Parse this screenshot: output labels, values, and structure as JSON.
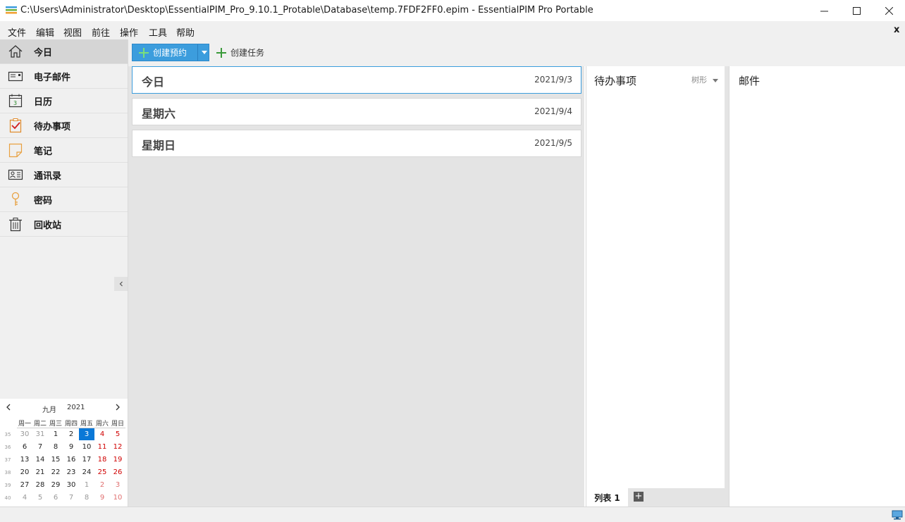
{
  "window": {
    "title": "C:\\Users\\Administrator\\Desktop\\EssentialPIM_Pro_9.10.1_Protable\\Database\\temp.7FDF2FF0.epim - EssentialPIM Pro Portable"
  },
  "menu": {
    "items": [
      "文件",
      "编辑",
      "视图",
      "前往",
      "操作",
      "工具",
      "帮助"
    ],
    "close": "x"
  },
  "sidebar": {
    "items": [
      {
        "label": "今日",
        "icon": "home-icon"
      },
      {
        "label": "电子邮件",
        "icon": "mail-icon"
      },
      {
        "label": "日历",
        "icon": "calendar-icon"
      },
      {
        "label": "待办事项",
        "icon": "todo-icon"
      },
      {
        "label": "笔记",
        "icon": "note-icon"
      },
      {
        "label": "通讯录",
        "icon": "contacts-icon"
      },
      {
        "label": "密码",
        "icon": "key-icon"
      },
      {
        "label": "回收站",
        "icon": "trash-icon"
      }
    ],
    "active_index": 0
  },
  "toolbar": {
    "new_appointment": "创建预约",
    "new_task": "创建任务"
  },
  "minical": {
    "month": "九月",
    "year": "2021",
    "weekdays": [
      "周一",
      "周二",
      "周三",
      "周四",
      "周五",
      "周六",
      "周日"
    ],
    "weeks": [
      {
        "num": "35",
        "days": [
          "30",
          "31",
          "1",
          "2",
          "3",
          "4",
          "5"
        ]
      },
      {
        "num": "36",
        "days": [
          "6",
          "7",
          "8",
          "9",
          "10",
          "11",
          "12"
        ]
      },
      {
        "num": "37",
        "days": [
          "13",
          "14",
          "15",
          "16",
          "17",
          "18",
          "19"
        ]
      },
      {
        "num": "38",
        "days": [
          "20",
          "21",
          "22",
          "23",
          "24",
          "25",
          "26"
        ]
      },
      {
        "num": "39",
        "days": [
          "27",
          "28",
          "29",
          "30",
          "1",
          "2",
          "3"
        ]
      },
      {
        "num": "40",
        "days": [
          "4",
          "5",
          "6",
          "7",
          "8",
          "9",
          "10"
        ]
      }
    ],
    "today": "3"
  },
  "days": [
    {
      "title": "今日",
      "date": "2021/9/3"
    },
    {
      "title": "星期六",
      "date": "2021/9/4"
    },
    {
      "title": "星期日",
      "date": "2021/9/5"
    }
  ],
  "todo": {
    "title": "待办事项",
    "view": "树形",
    "tab": "列表 1",
    "add_tab": "+"
  },
  "mail": {
    "title": "邮件"
  },
  "colors": {
    "accent": "#3c9ddd",
    "weekend": "#d00000",
    "today_bg": "#0a78d7"
  }
}
